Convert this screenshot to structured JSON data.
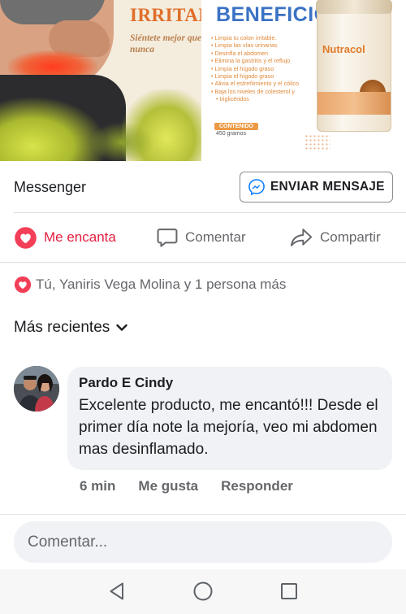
{
  "ad": {
    "left_title": "IRRITAB",
    "tagline": "Siéntete mejor que nunca",
    "right_title": "BENEFICIOS",
    "benefits": [
      "Limpia tu colon irritable.",
      "Limpia las vías urinarias",
      "Desinfla el abdomen",
      "Elimina la gastritis y el reflujo",
      "Limpia el hígado graso",
      "Limpia el hígado graso",
      "Alivia el estreñimiento y el cólico",
      "Baja los niveles de colesterol y",
      "triglicéridos"
    ],
    "content_label": "CONTENIDO",
    "content_weight": "450 gramos",
    "product_name": "Nutracol"
  },
  "messenger": {
    "label": "Messenger",
    "send_button": "ENVIAR MENSAJE"
  },
  "actions": {
    "like": "Me encanta",
    "comment": "Comentar",
    "share": "Compartir"
  },
  "reactions": {
    "text": "Tú, Yaniris Vega Molina y 1 persona más"
  },
  "sort": {
    "label": "Más recientes"
  },
  "comment": {
    "author": "Pardo E Cindy",
    "text": "Excelente producto, me encantó!!! Desde el primer día note la mejoría, veo mi abdomen mas desinflamado.",
    "time": "6 min",
    "like": "Me gusta",
    "reply": "Responder"
  },
  "composer": {
    "placeholder": "Comentar..."
  },
  "colors": {
    "accent_red": "#e41e3f",
    "messenger_blue": "#0a7cff",
    "secondary_text": "#65676b"
  }
}
